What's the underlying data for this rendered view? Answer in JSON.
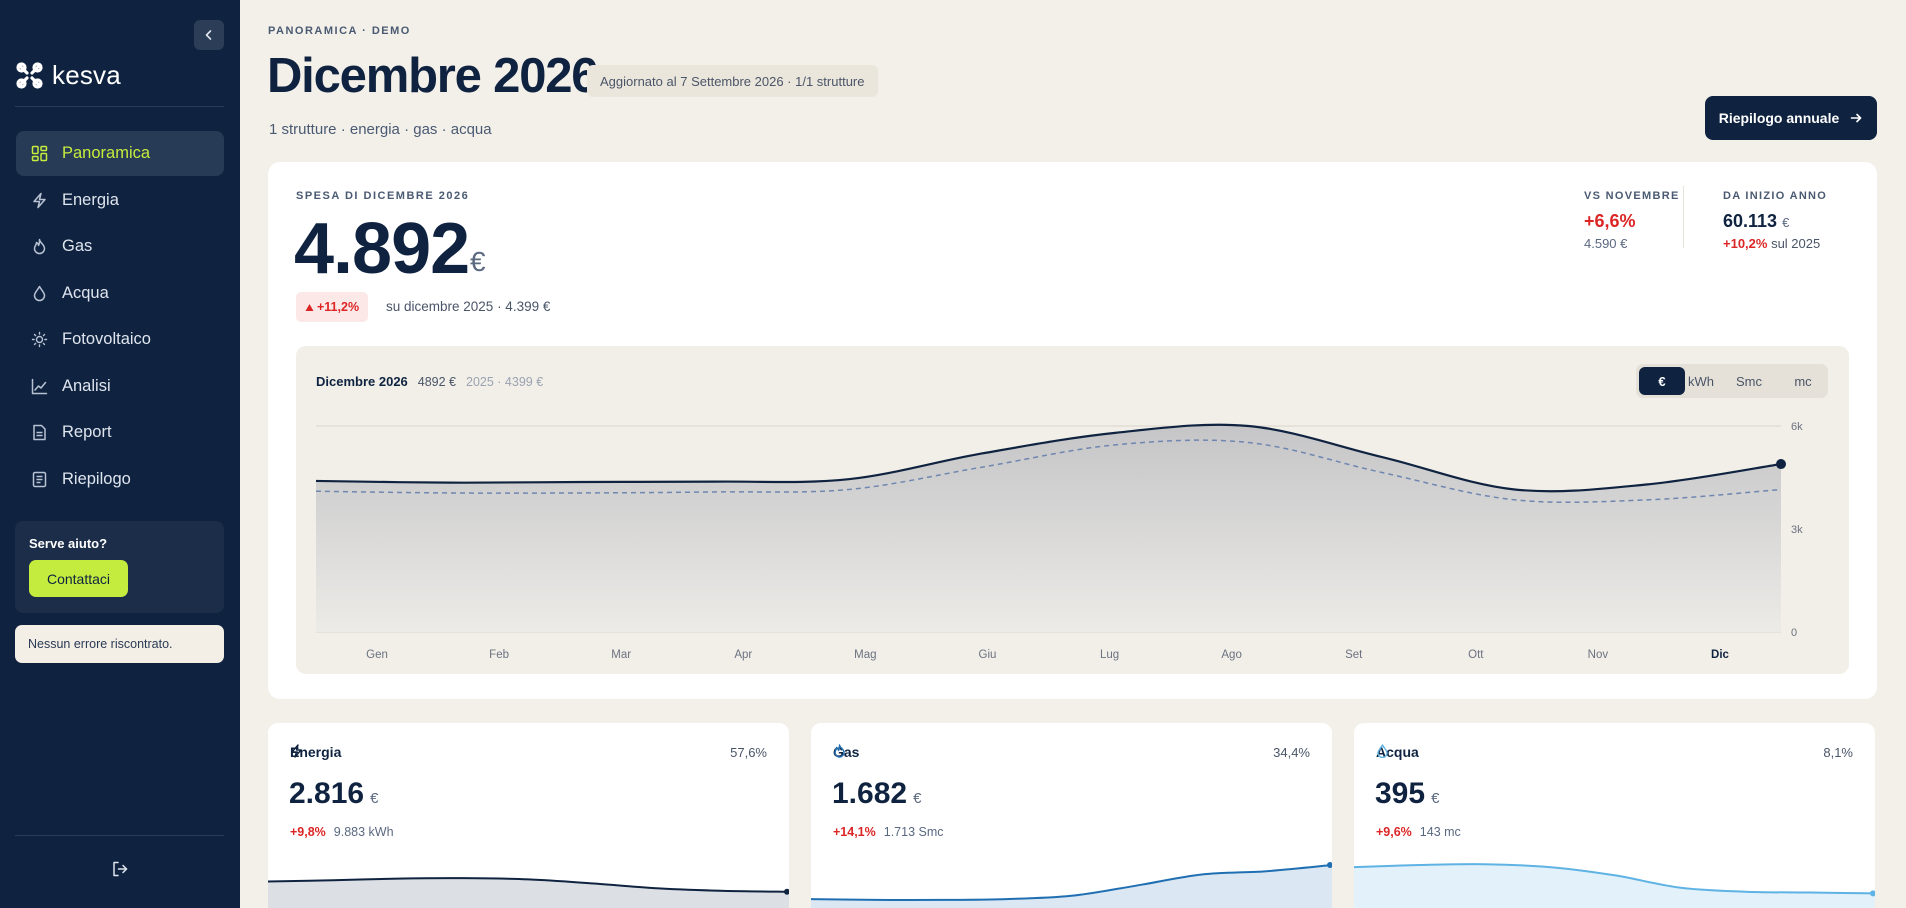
{
  "brand": {
    "name": "kesva"
  },
  "sidebar": {
    "items": [
      {
        "label": "Panoramica",
        "icon": "grid-icon",
        "active": true
      },
      {
        "label": "Energia",
        "icon": "bolt-icon",
        "active": false
      },
      {
        "label": "Gas",
        "icon": "flame-icon",
        "active": false
      },
      {
        "label": "Acqua",
        "icon": "droplet-icon",
        "active": false
      },
      {
        "label": "Fotovoltaico",
        "icon": "sun-icon",
        "active": false
      },
      {
        "label": "Analisi",
        "icon": "trend-icon",
        "active": false
      },
      {
        "label": "Report",
        "icon": "document-icon",
        "active": false
      },
      {
        "label": "Riepilogo",
        "icon": "list-icon",
        "active": false
      }
    ],
    "help": {
      "title": "Serve aiuto?",
      "button": "Contattaci"
    },
    "status": "Nessun errore riscontrato."
  },
  "header": {
    "eyebrow": "PANORAMICA · DEMO",
    "title": "Dicembre 2026",
    "updated": "Aggiornato al 7 Settembre 2026 · 1/1 strutture",
    "subtitle": "1 strutture · energia · gas · acqua",
    "annual_button": "Riepilogo annuale"
  },
  "summary": {
    "label": "SPESA DI DICEMBRE 2026",
    "value": "4.892",
    "currency": "€",
    "delta": "+11,2%",
    "delta_note": "su dicembre 2025 · 4.399 €",
    "vs_label": "VS NOVEMBRE",
    "vs_value": "+6,6%",
    "vs_sub": "4.590 €",
    "ytd_label": "DA INIZIO ANNO",
    "ytd_value": "60.113",
    "ytd_currency": "€",
    "ytd_delta": "+10,2%",
    "ytd_note": "sul 2025"
  },
  "chart_header": {
    "title": "Dicembre 2026",
    "current": "4892 €",
    "previous": "2025 · 4399 €"
  },
  "units": [
    "€",
    "kWh",
    "Smc",
    "mc"
  ],
  "active_unit": "€",
  "colors": {
    "navy": "#0f2340",
    "accent": "#c3ec3e",
    "negative": "#dc2626",
    "blue": "#1f6fb2",
    "light_blue": "#5fb3e4"
  },
  "chart_data": {
    "type": "area",
    "categories": [
      "Gen",
      "Feb",
      "Mar",
      "Apr",
      "Mag",
      "Giu",
      "Lug",
      "Ago",
      "Set",
      "Ott",
      "Nov",
      "Dic"
    ],
    "highlight_category": "Dic",
    "ylim": [
      0,
      6000
    ],
    "y_ticks": [
      "0",
      "3k",
      "6k"
    ],
    "grid": true,
    "series": [
      {
        "values": [
          4400,
          4350,
          4370,
          4380,
          4450,
          5200,
          5800,
          6000,
          5100,
          4150,
          4300,
          4892
        ],
        "style": "solid"
      },
      {
        "values": [
          4100,
          4050,
          4050,
          4080,
          4150,
          4800,
          5450,
          5520,
          4650,
          3850,
          3850,
          4150
        ],
        "style": "dashed"
      }
    ]
  },
  "cards": [
    {
      "name": "Energia",
      "icon": "bolt-icon",
      "share": "57,6%",
      "value": "2.816",
      "currency": "€",
      "delta": "+9,8%",
      "sub": "9.883 kWh",
      "color": "#0f2340",
      "fill": "#dcdfe3",
      "trend": [
        0.55,
        0.58,
        0.62,
        0.63,
        0.6,
        0.5,
        0.38,
        0.32,
        0.3
      ]
    },
    {
      "name": "Gas",
      "icon": "flame-icon",
      "share": "34,4%",
      "value": "1.682",
      "currency": "€",
      "delta": "+14,1%",
      "sub": "1.713 Smc",
      "color": "#1f6fb2",
      "fill": "#dbe7f2",
      "trend": [
        0.12,
        0.1,
        0.1,
        0.12,
        0.2,
        0.45,
        0.72,
        0.8,
        0.95
      ]
    },
    {
      "name": "Acqua",
      "icon": "droplet-icon",
      "share": "8,1%",
      "value": "395",
      "currency": "€",
      "delta": "+9,6%",
      "sub": "143 mc",
      "color": "#5fb3e4",
      "fill": "#e2f1fa",
      "trend": [
        0.9,
        0.95,
        0.97,
        0.9,
        0.7,
        0.4,
        0.3,
        0.28,
        0.26
      ]
    }
  ]
}
